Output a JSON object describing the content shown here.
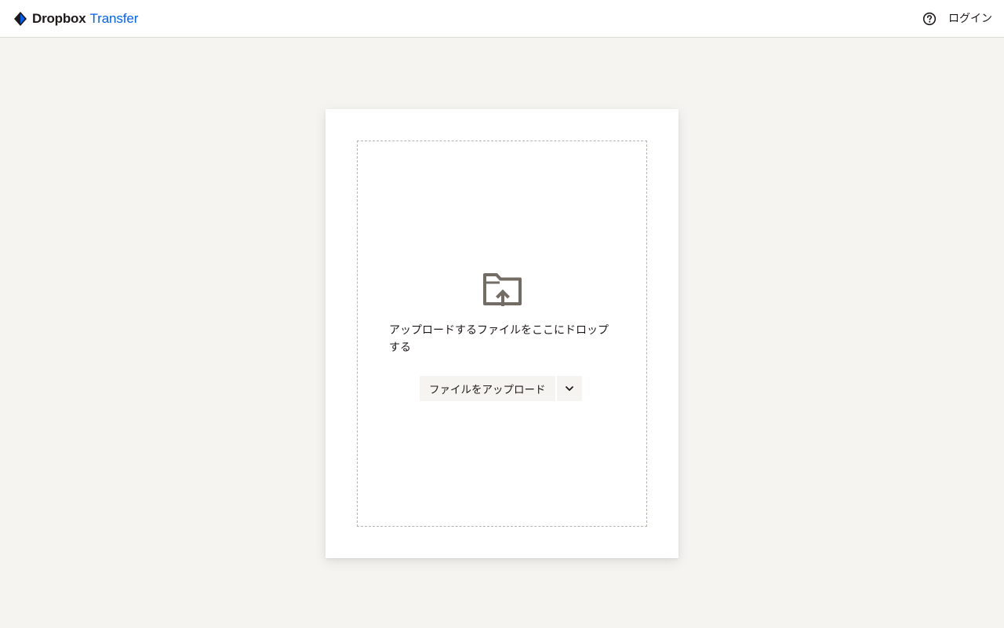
{
  "header": {
    "brand_name": "Dropbox",
    "brand_product": "Transfer",
    "help_icon": "help-circle-icon",
    "login_label": "ログイン"
  },
  "dropzone": {
    "icon": "folder-upload-icon",
    "instruction": "アップロードするファイルをここにドロップする",
    "upload_button_label": "ファイルをアップロード",
    "dropdown_icon": "chevron-down-icon"
  },
  "colors": {
    "background": "#f5f4f0",
    "brand_blue": "#0061fe",
    "text": "#1e1919",
    "icon_gray": "#736c64"
  }
}
